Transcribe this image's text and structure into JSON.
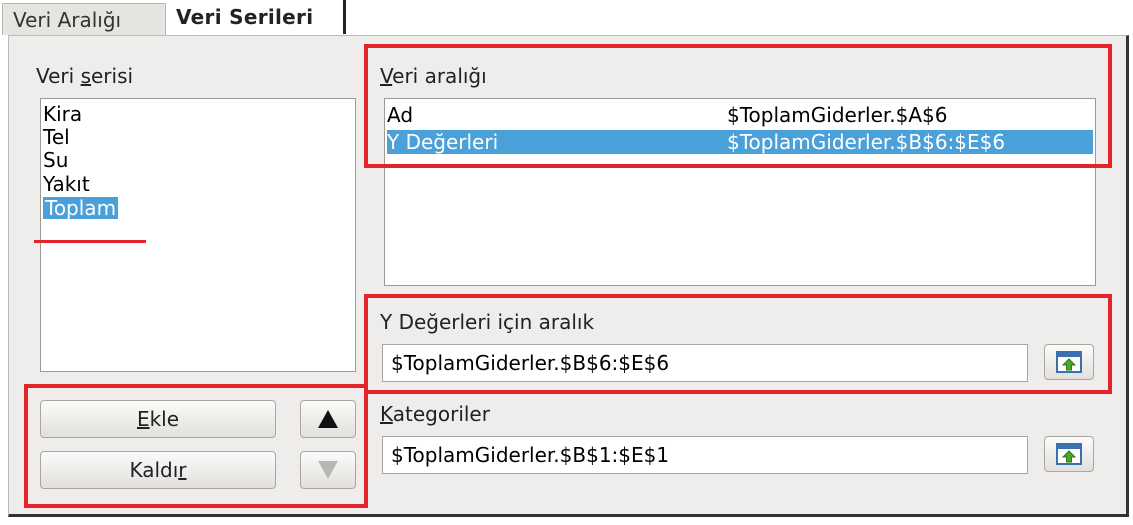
{
  "tabs": [
    {
      "label": "Veri Aralığı",
      "active": false
    },
    {
      "label": "Veri Serileri",
      "active": true
    }
  ],
  "series_panel": {
    "label_prefix": "Veri ",
    "label_mnemonic": "s",
    "label_rest": "erisi",
    "items": [
      "Kira",
      "Tel",
      "Su",
      "Yakıt",
      "Toplam"
    ],
    "selected_index": 4
  },
  "buttons": {
    "add": {
      "mnemonic": "E",
      "rest": "kle"
    },
    "remove": {
      "prefix": "Kaldı",
      "mnemonic": "r"
    },
    "move_up": {
      "icon": "triangle-up-icon",
      "enabled": true
    },
    "move_down": {
      "icon": "triangle-down-icon",
      "enabled": false
    }
  },
  "data_range": {
    "label_mnemonic": "V",
    "label_rest": "eri aralığı",
    "rows": [
      {
        "role": "Ad",
        "range": "$ToplamGiderler.$A$6"
      },
      {
        "role": "Y Değerleri",
        "range": "$ToplamGiderler.$B$6:$E$6"
      }
    ],
    "selected_index": 1
  },
  "y_range": {
    "label": "Y Değerleri için aralık",
    "value": "$ToplamGiderler.$B$6:$E$6",
    "shrink_icon": "shrink-range-icon"
  },
  "categories": {
    "label_mnemonic": "K",
    "label_rest": "ategoriler",
    "value": "$ToplamGiderler.$B$1:$E$1",
    "shrink_icon": "shrink-range-icon"
  },
  "colors": {
    "selection": "#4aa1d9",
    "highlight_annotation": "#e3242b"
  }
}
